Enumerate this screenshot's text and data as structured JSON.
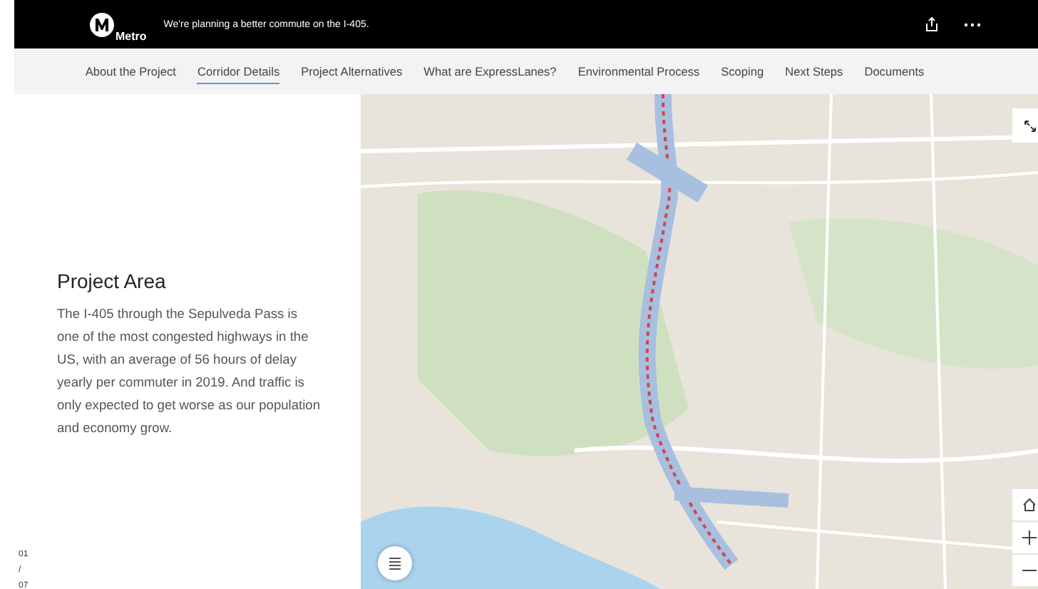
{
  "header": {
    "logo_text": "Metro",
    "tagline": "We're planning a better commute on the I-405."
  },
  "nav": [
    {
      "label": "About the Project",
      "selected": false
    },
    {
      "label": "Corridor Details",
      "selected": true
    },
    {
      "label": "Project Alternatives",
      "selected": false
    },
    {
      "label": "What are ExpressLanes?",
      "selected": false
    },
    {
      "label": "Environmental Process",
      "selected": false
    },
    {
      "label": "Scoping",
      "selected": false
    },
    {
      "label": "Next Steps",
      "selected": false
    },
    {
      "label": "Documents",
      "selected": false
    }
  ],
  "panel": {
    "title": "Project Area",
    "body": "The I-405 through the Sepulveda Pass is one of the most congested highways in the US, with an average of 56 hours of delay yearly per commuter in 2019. And traffic is only expected to get worse as our population and economy grow.",
    "counter": {
      "current": "01",
      "separator": "/",
      "total": "07"
    }
  }
}
